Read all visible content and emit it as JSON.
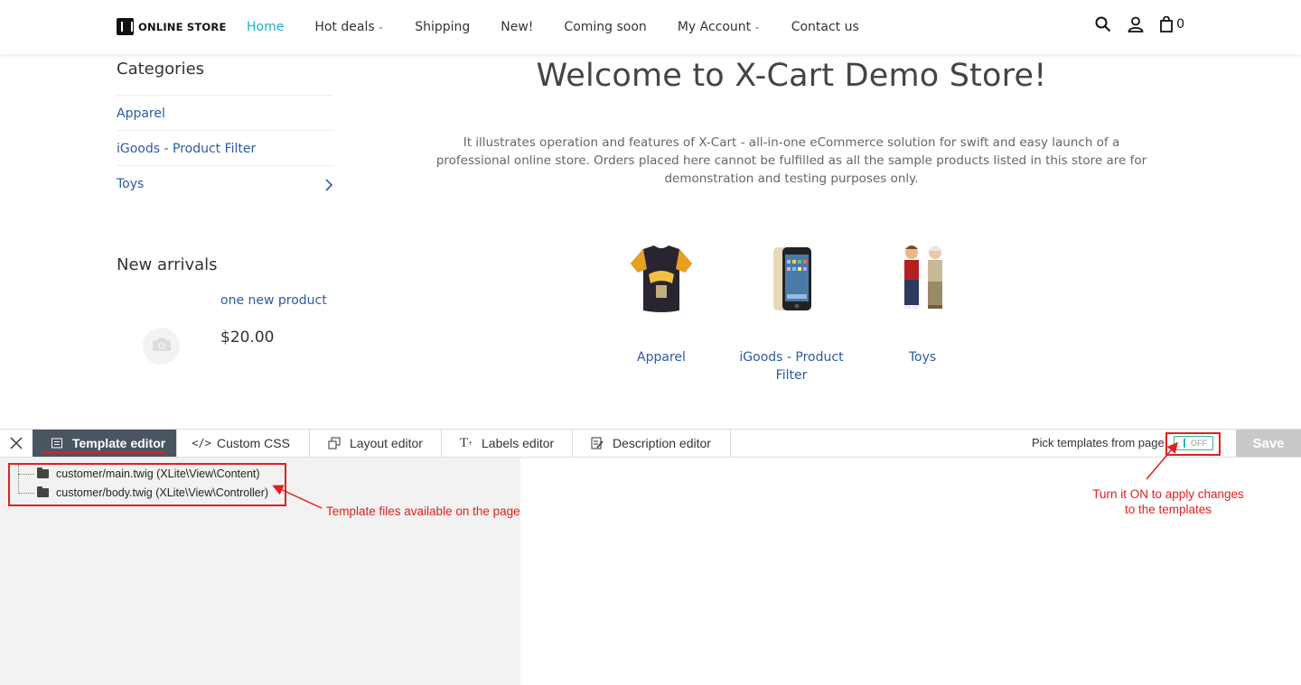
{
  "header": {
    "logo_text": "ONLINE STORE",
    "nav": [
      {
        "label": "Home",
        "active": true,
        "dropdown": false
      },
      {
        "label": "Hot deals",
        "active": false,
        "dropdown": true
      },
      {
        "label": "Shipping",
        "active": false,
        "dropdown": false
      },
      {
        "label": "New!",
        "active": false,
        "dropdown": false
      },
      {
        "label": "Coming soon",
        "active": false,
        "dropdown": false
      },
      {
        "label": "My Account",
        "active": false,
        "dropdown": true
      },
      {
        "label": "Contact us",
        "active": false,
        "dropdown": false
      }
    ],
    "cart_count": "0",
    "icons": [
      "search-icon",
      "user-icon",
      "cart-icon"
    ]
  },
  "sidebar": {
    "categories_title": "Categories",
    "categories": [
      {
        "label": "Apparel",
        "has_children": false
      },
      {
        "label": "iGoods - Product Filter",
        "has_children": false
      },
      {
        "label": "Toys",
        "has_children": true
      }
    ],
    "new_arrivals_title": "New arrivals",
    "new_arrival": {
      "name": "one new product",
      "price": "$20.00"
    }
  },
  "main": {
    "title": "Welcome to X-Cart Demo Store!",
    "intro": "It illustrates operation and features of X-Cart - all-in-one eCommerce solution for swift and easy launch of a professional online store. Orders placed here cannot be fulfilled as all the sample products listed in this store are for demonstration and testing purposes only.",
    "categories": [
      {
        "label": "Apparel"
      },
      {
        "label": "iGoods - Product Filter"
      },
      {
        "label": "Toys"
      }
    ]
  },
  "editor": {
    "tabs": [
      {
        "label": "Template editor",
        "active": true,
        "icon": "template-icon"
      },
      {
        "label": "Custom CSS",
        "active": false,
        "icon": "code-icon"
      },
      {
        "label": "Layout editor",
        "active": false,
        "icon": "layout-icon"
      },
      {
        "label": "Labels editor",
        "active": false,
        "icon": "text-icon"
      },
      {
        "label": "Description editor",
        "active": false,
        "icon": "edit-doc-icon"
      }
    ],
    "pick_label": "Pick templates from page",
    "toggle_state": "OFF",
    "save_label": "Save",
    "tree": [
      "customer/main.twig (XLite\\View\\Content)",
      "customer/body.twig (XLite\\View\\Controller)"
    ]
  },
  "annotations": {
    "tree_note": "Template files available on the page",
    "toggle_note_line1": "Turn it ON to apply changes",
    "toggle_note_line2": "to the templates"
  },
  "colors": {
    "accent": "#19b2c9",
    "link": "#2c5aa0",
    "annotation": "#e02020",
    "active_tab": "#4a5561"
  }
}
